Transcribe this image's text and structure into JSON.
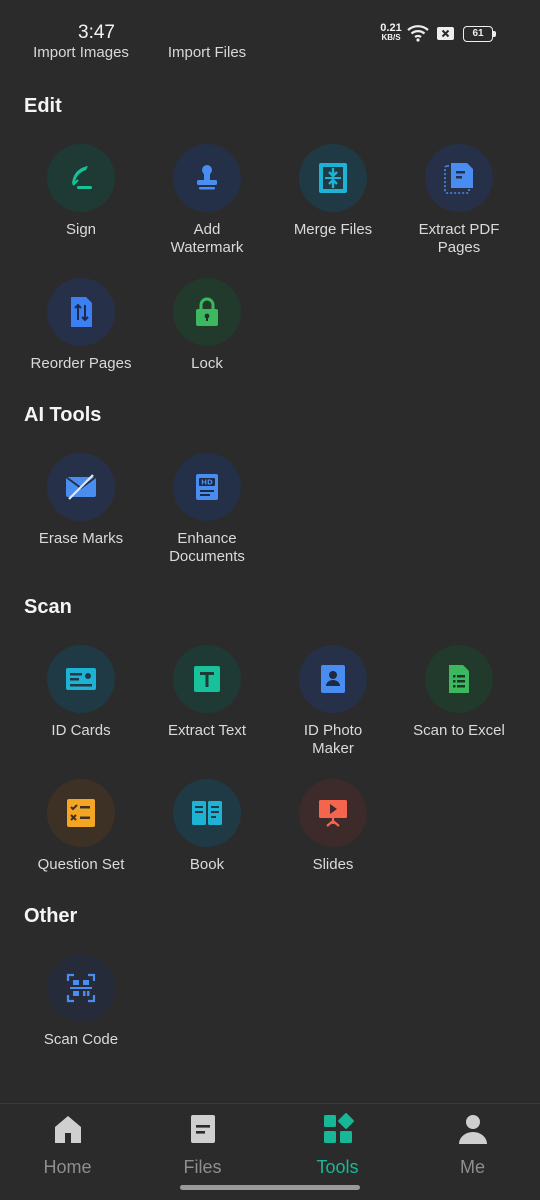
{
  "status": {
    "time": "3:47",
    "net_value": "0.21",
    "net_unit": "KB/S",
    "battery": "61"
  },
  "partial_row": [
    "Import Images",
    "Import Files"
  ],
  "sections": [
    {
      "title": "Edit",
      "tools": [
        {
          "label": "Sign",
          "icon": "quill-pen-icon"
        },
        {
          "label": "Add Watermark",
          "icon": "stamp-icon"
        },
        {
          "label": "Merge Files",
          "icon": "merge-icon"
        },
        {
          "label": "Extract PDF Pages",
          "icon": "extract-pages-icon"
        },
        {
          "label": "Reorder Pages",
          "icon": "reorder-icon"
        },
        {
          "label": "Lock",
          "icon": "lock-icon"
        }
      ]
    },
    {
      "title": "AI Tools",
      "tools": [
        {
          "label": "Erase Marks",
          "icon": "erase-icon"
        },
        {
          "label": "Enhance Documents",
          "icon": "hd-document-icon"
        }
      ]
    },
    {
      "title": "Scan",
      "tools": [
        {
          "label": "ID Cards",
          "icon": "id-card-icon"
        },
        {
          "label": "Extract Text",
          "icon": "text-icon"
        },
        {
          "label": "ID Photo Maker",
          "icon": "id-photo-icon"
        },
        {
          "label": "Scan to Excel",
          "icon": "spreadsheet-icon"
        },
        {
          "label": "Question Set",
          "icon": "question-set-icon"
        },
        {
          "label": "Book",
          "icon": "book-icon"
        },
        {
          "label": "Slides",
          "icon": "slides-icon"
        }
      ]
    },
    {
      "title": "Other",
      "tools": [
        {
          "label": "Scan Code",
          "icon": "qr-code-icon"
        }
      ]
    }
  ],
  "nav": [
    {
      "label": "Home",
      "icon": "home-icon",
      "active": false
    },
    {
      "label": "Files",
      "icon": "file-icon",
      "active": false
    },
    {
      "label": "Tools",
      "icon": "tools-grid-icon",
      "active": true
    },
    {
      "label": "Me",
      "icon": "person-icon",
      "active": false
    }
  ],
  "colors": {
    "background": "#2b2b2b",
    "accent": "#17b897"
  }
}
